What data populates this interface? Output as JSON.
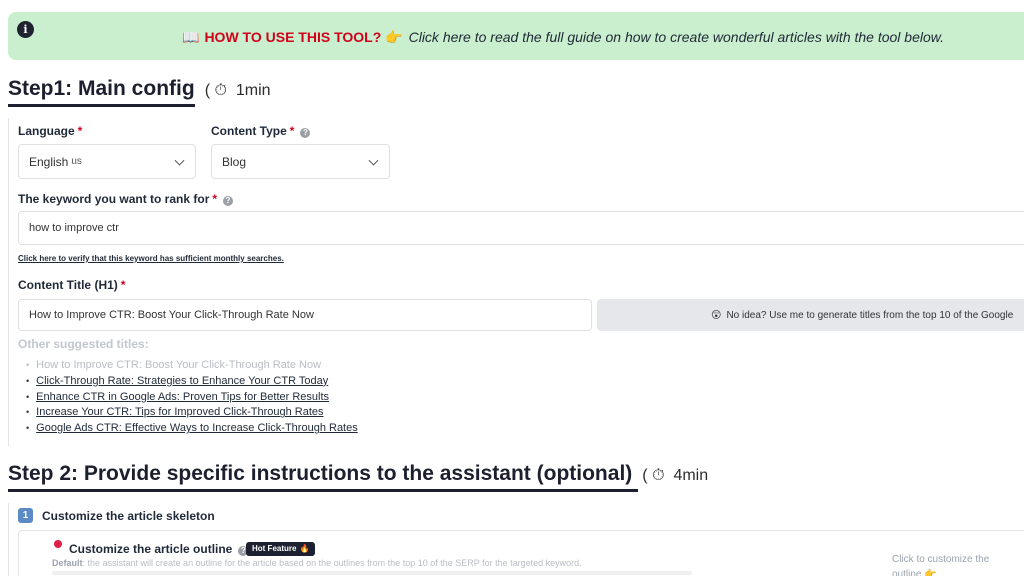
{
  "banner": {
    "book_emoji": "📖",
    "strong_text": "HOW TO USE THIS TOOL?",
    "pointing_emoji": "👉",
    "body_text": "Click here to read the full guide on how to create wonderful articles with the tool below."
  },
  "step1": {
    "title": "Step1: Main config",
    "time_open": "(",
    "time_icon": "⏱",
    "time": "1min"
  },
  "language": {
    "label": "Language",
    "required": "*",
    "value": "English",
    "value_sub": "us"
  },
  "content_type": {
    "label": "Content Type",
    "required": "*",
    "value": "Blog"
  },
  "keyword": {
    "label": "The keyword you want to rank for",
    "required": "*",
    "value": "how to improve ctr",
    "verify_link": "Click here to verify that this keyword has sufficient monthly searches."
  },
  "content_title": {
    "label": "Content Title (H1)",
    "required": "*",
    "value": "How to Improve CTR: Boost Your Click-Through Rate Now",
    "generate_emoji": "😲",
    "generate_button": "No idea? Use me to generate titles from the top 10 of the Google"
  },
  "suggested": {
    "label": "Other suggested titles:",
    "items": [
      "How to Improve CTR: Boost Your Click-Through Rate Now",
      "Click-Through Rate: Strategies to Enhance Your CTR Today",
      "Enhance CTR in Google Ads: Proven Tips for Better Results",
      "Increase Your CTR: Tips for Improved Click-Through Rates",
      "Google Ads CTR: Effective Ways to Increase Click-Through Rates"
    ]
  },
  "step2": {
    "title": "Step 2: Provide specific instructions to the assistant (optional)",
    "time_open": "(",
    "time_icon": "⏱",
    "time": "4min"
  },
  "skeleton": {
    "number": "1",
    "label": "Customize the article skeleton",
    "card_title": "Customize the article outline",
    "hot_label": "Hot Feature",
    "hot_icon": "🔥",
    "desc_bold": "Default",
    "desc": ": the assistant will create an outline for the article based on the outlines from the top 10 of the SERP for the targeted keyword.",
    "cta": "Click to customize the outline 👉"
  }
}
